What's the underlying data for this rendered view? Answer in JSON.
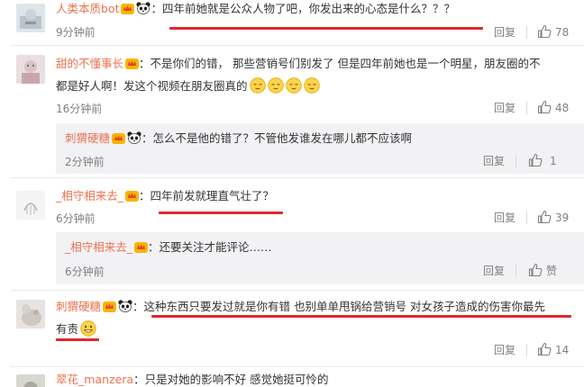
{
  "colors": {
    "username": "#eb7350",
    "underline": "#e0282e",
    "meta": "#808080",
    "reply_bg": "#f2f2f5"
  },
  "comments": [
    {
      "name": "人类本质bot",
      "text": "四年前她就是公众人物了吧，你发出来的心态是什么？？？",
      "time": "9分钟前",
      "reply": "回复",
      "likes": "78"
    },
    {
      "name": "甜的不懂事长",
      "text_1": "不是你们的错， 那些营销号们别发了 但是四年前她也是一个明星，朋友圈的不",
      "text_2": "都是好人啊！发这个视频在朋友圈真的",
      "time": "16分钟前",
      "reply": "回复",
      "likes": "48",
      "reply_item": {
        "name": "刺猬硬糖",
        "text": "怎么不是他的错了？不管他发谁发在哪儿都不应该啊",
        "time": "2分钟前",
        "reply": "回复",
        "likes": "1"
      }
    },
    {
      "name": "_相守相来去_",
      "text": "四年前发就理直气壮了？",
      "time": "6分钟前",
      "reply": "回复",
      "likes": "39",
      "reply_item": {
        "name": "_相守相来去_",
        "text": "还要关注才能评论……",
        "time": "6分钟前",
        "reply": "回复",
        "likes": "赞"
      }
    },
    {
      "name": "刺猬硬糖",
      "text_1": "这种东西只要发过就是你有错 也别单单甩锅给营销号 对女孩子造成的伤害你最先",
      "text_2": "有责",
      "time": "",
      "reply": "回复",
      "likes": "14"
    },
    {
      "name": "翠花_manzera",
      "text": "只是对她的影响不好  感觉她挺可怜的"
    }
  ],
  "punct": {
    "colon": "："
  },
  "icons": [
    "thumb-up-icon",
    "vip-crown-badge-icon",
    "panda-emoji-icon",
    "grin-emoji-icon",
    "sleepy-emoji-icon"
  ]
}
